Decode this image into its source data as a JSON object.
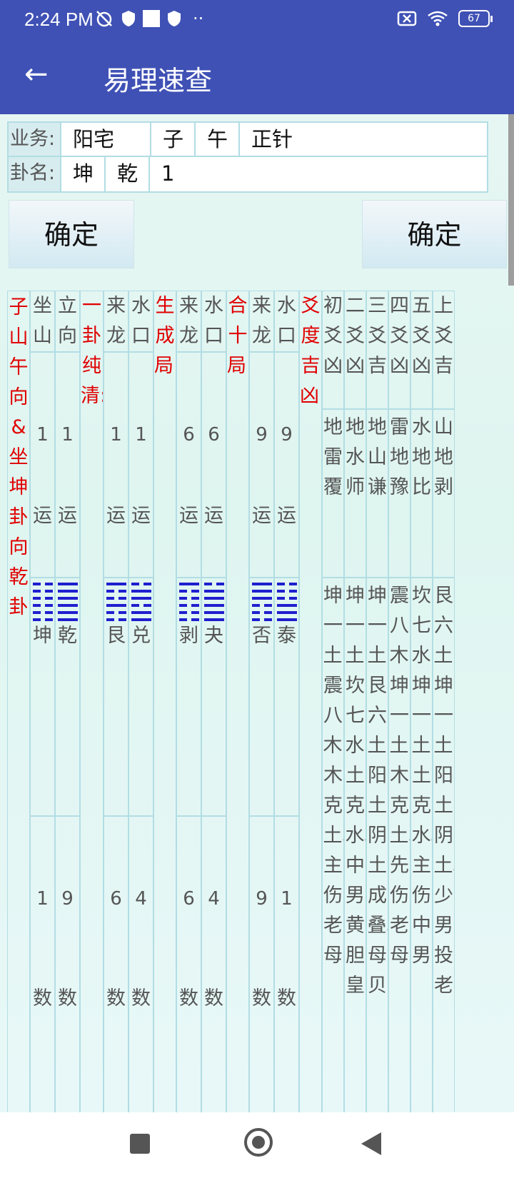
{
  "status": {
    "time": "2:24 PM",
    "battery": "67",
    "dots": "··"
  },
  "appbar": {
    "title": "易理速查",
    "back": "←"
  },
  "form": {
    "row1_label": "业务:",
    "row1_cells": [
      "阳宅",
      "子",
      "午",
      "正针"
    ],
    "row2_label": "卦名:",
    "row2_cells": [
      "坤",
      "乾",
      "1"
    ]
  },
  "buttons": {
    "confirm_left": "确定",
    "confirm_right": "确定"
  },
  "grid": {
    "main_label": "子山午向\n&\n坐坤卦向乾卦",
    "header_pairs": [
      "坐山",
      "立向",
      "来龙",
      "水口",
      "来龙",
      "水口",
      "来龙",
      "水口"
    ],
    "section_labels": [
      "一卦纯清:",
      "生成局:",
      "合十局:",
      "爻度吉凶:"
    ],
    "yun_values": [
      "1",
      "1",
      "1",
      "1",
      "6",
      "6",
      "9",
      "9"
    ],
    "yun_unit": "运",
    "gua_names": [
      "坤",
      "乾",
      "艮",
      "兑",
      "剥",
      "夬",
      "否",
      "泰"
    ],
    "shu_values": [
      "1",
      "9",
      "6",
      "4",
      "6",
      "4",
      "9",
      "1"
    ],
    "shu_unit": "数",
    "yao_headers": [
      "初爻",
      "二爻",
      "三爻",
      "四爻",
      "五爻",
      "上爻"
    ],
    "yao_jx": [
      "凶",
      "凶",
      "吉",
      "凶",
      "凶",
      "吉"
    ],
    "yao_gua": [
      "地雷覆",
      "地水师",
      "地山谦",
      "雷地豫",
      "水地比",
      "山地剥"
    ],
    "yao_notes": [
      "坤一土,震八木,木克土。主伤老母",
      "坤一土,坎七水,土克水。中男黄胆皇",
      "坤一土,艮六土,阳土阴土成叠。母贝",
      "震八木,坤一土,木克土。先伤老母",
      "坎七水,坤一土,土克水。主伤中男",
      "艮六土,坤一土,阳土阴土。少男投老"
    ]
  }
}
